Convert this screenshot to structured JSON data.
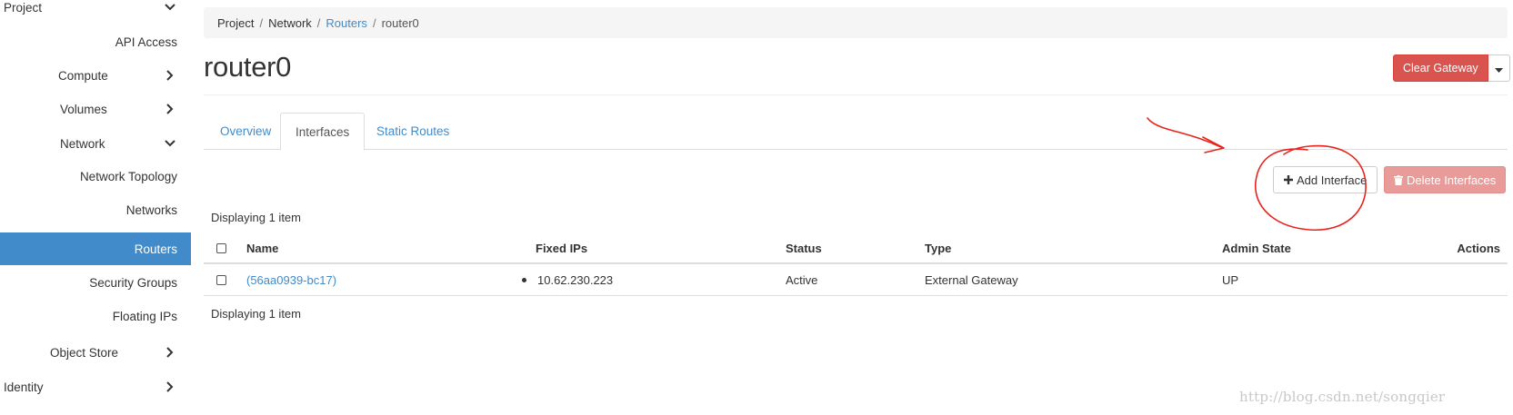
{
  "sidebar": {
    "project": "Project",
    "api_access": "API Access",
    "compute": "Compute",
    "volumes": "Volumes",
    "network": "Network",
    "network_topology": "Network Topology",
    "networks": "Networks",
    "routers": "Routers",
    "security_groups": "Security Groups",
    "floating_ips": "Floating IPs",
    "object_store": "Object Store",
    "identity": "Identity"
  },
  "breadcrumb": {
    "items": [
      "Project",
      "Network",
      "Routers",
      "router0"
    ],
    "separator": "/"
  },
  "page": {
    "title": "router0",
    "clear_gateway_label": "Clear Gateway"
  },
  "tabs": [
    "Overview",
    "Interfaces",
    "Static Routes"
  ],
  "actions": {
    "add_interface_label": "Add Interface",
    "delete_interfaces_label": "Delete Interfaces"
  },
  "table": {
    "count_top": "Displaying 1 item",
    "count_bottom": "Displaying 1 item",
    "columns": [
      "Name",
      "Fixed IPs",
      "Status",
      "Type",
      "Admin State",
      "Actions"
    ],
    "rows": [
      {
        "name": "(56aa0939-bc17)",
        "fixed_ips": [
          "10.62.230.223"
        ],
        "status": "Active",
        "type": "External Gateway",
        "admin_state": "UP"
      }
    ]
  },
  "watermark": "http://blog.csdn.net/songqier",
  "colors": {
    "primary": "#428bca",
    "danger": "#d9534f",
    "danger_disabled": "#e89b98",
    "annotation": "#e8231c"
  }
}
